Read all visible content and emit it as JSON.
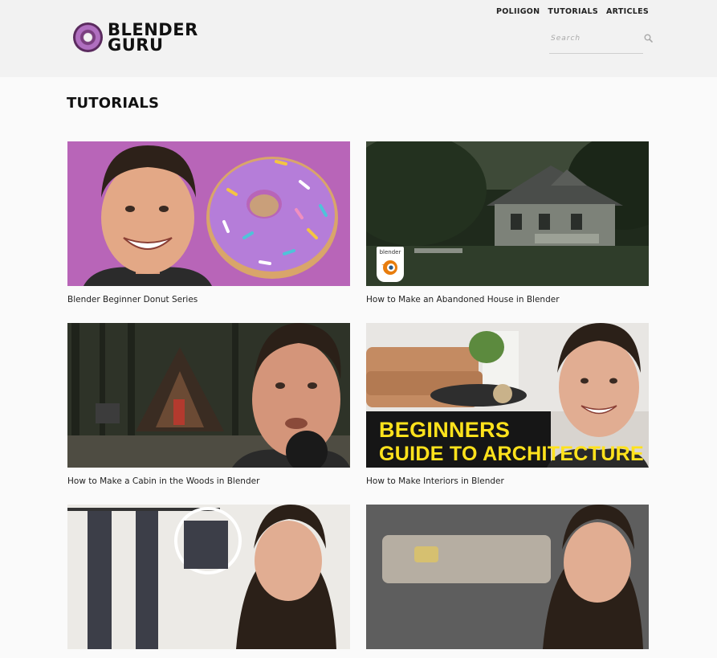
{
  "header": {
    "logo_line1": "BLENDER",
    "logo_line2": "GURU",
    "nav": [
      "POLIIGON",
      "TUTORIALS",
      "ARTICLES"
    ],
    "search_placeholder": "Search"
  },
  "main": {
    "title": "TUTORIALS",
    "cards": [
      {
        "caption": "Blender Beginner Donut Series"
      },
      {
        "caption": "How to Make an Abandoned House in Blender",
        "badge": "blender"
      },
      {
        "caption": "How to Make a Cabin in the Woods in Blender"
      },
      {
        "caption": "How to Make Interiors in Blender",
        "overlay_line1": "BEGINNERS",
        "overlay_line2": "GUIDE TO ARCHITECTURE"
      },
      {
        "caption": ""
      },
      {
        "caption": ""
      }
    ]
  },
  "colors": {
    "header_bg": "#f2f2f2",
    "page_bg": "#fafafa",
    "donut_bg": "#b865b8",
    "overlay_text": "#ffe21c"
  }
}
